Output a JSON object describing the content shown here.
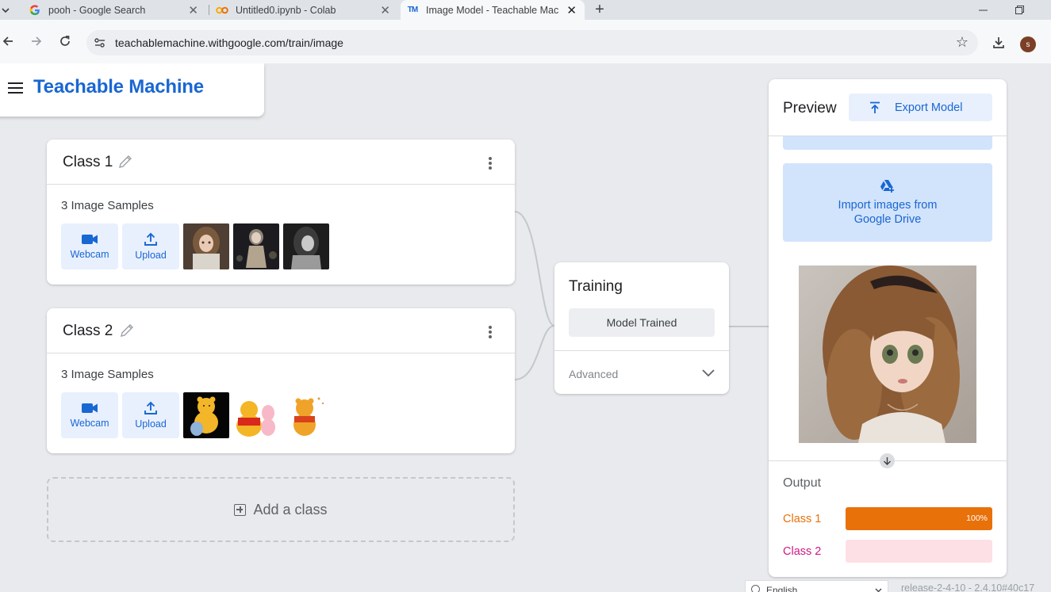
{
  "browser": {
    "tabs": [
      {
        "title": "pooh - Google Search",
        "favicon": "google-g"
      },
      {
        "title": "Untitled0.ipynb - Colab",
        "favicon": "colab-co"
      },
      {
        "title": "Image Model - Teachable Mach",
        "favicon": "tm-logo",
        "active": true
      }
    ],
    "favicon_text": {
      "google": "G",
      "colab": "CO",
      "tm": "TM"
    },
    "url": "teachablemachine.withgoogle.com/train/image",
    "profile_initial": "s"
  },
  "app": {
    "title": "Teachable Machine"
  },
  "classes": [
    {
      "name": "Class 1",
      "samples_label": "3 Image Samples",
      "webcam_label": "Webcam",
      "upload_label": "Upload",
      "thumbnails": [
        "doll-image-1",
        "doll-image-2",
        "doll-image-3"
      ]
    },
    {
      "name": "Class 2",
      "samples_label": "3 Image Samples",
      "webcam_label": "Webcam",
      "upload_label": "Upload",
      "thumbnails": [
        "pooh-image-1",
        "pooh-image-2",
        "pooh-image-3"
      ]
    }
  ],
  "add_class_label": "Add a class",
  "training": {
    "title": "Training",
    "button_label": "Model Trained",
    "advanced_label": "Advanced"
  },
  "preview": {
    "title": "Preview",
    "export_label": "Export Model",
    "import_drive_line1": "Import images from",
    "import_drive_line2": "Google Drive",
    "output_title": "Output",
    "outputs": [
      {
        "label": "Class 1",
        "percent": 100,
        "percent_label": "100%",
        "color": "#e8710a",
        "label_color": "#e8710a"
      },
      {
        "label": "Class 2",
        "percent": 0,
        "percent_label": "",
        "color": "#fde0e5",
        "label_color": "#d01884"
      }
    ]
  },
  "footer": {
    "language": "English",
    "release": "release-2-4-10 - 2.4.10#40c17"
  },
  "colors": {
    "brand_blue": "#1967d2",
    "light_blue": "#e8f0fe",
    "page_bg": "#e8eaed"
  }
}
